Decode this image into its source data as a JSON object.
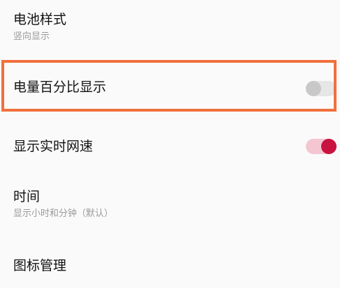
{
  "settings": {
    "battery_style": {
      "title": "电池样式",
      "subtitle": "竖向显示"
    },
    "battery_percentage": {
      "title": "电量百分比显示",
      "enabled": false
    },
    "realtime_speed": {
      "title": "显示实时网速",
      "enabled": true
    },
    "time": {
      "title": "时间",
      "subtitle": "显示小时和分钟（默认）"
    },
    "icon_management": {
      "title": "图标管理"
    }
  },
  "colors": {
    "highlight_border": "#f0703c",
    "toggle_on_thumb": "#c8123f",
    "toggle_on_track": "#f4c6d1",
    "toggle_off_thumb": "#c8c8c8",
    "toggle_off_track": "#e6e6e6"
  }
}
